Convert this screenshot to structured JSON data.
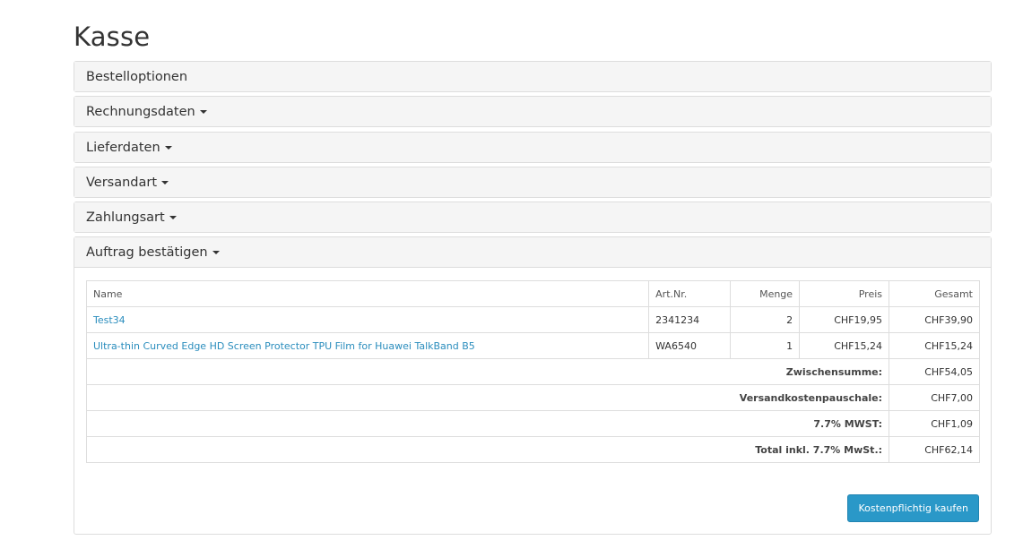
{
  "page": {
    "title": "Kasse"
  },
  "sections": [
    {
      "label": "Bestelloptionen",
      "caret": false
    },
    {
      "label": "Rechnungsdaten",
      "caret": true
    },
    {
      "label": "Lieferdaten",
      "caret": true
    },
    {
      "label": "Versandart",
      "caret": true
    },
    {
      "label": "Zahlungsart",
      "caret": true
    },
    {
      "label": "Auftrag bestätigen",
      "caret": true
    }
  ],
  "table": {
    "headers": {
      "name": "Name",
      "artnr": "Art.Nr.",
      "menge": "Menge",
      "preis": "Preis",
      "gesamt": "Gesamt"
    },
    "rows": [
      {
        "name": "Test34",
        "artnr": "2341234",
        "menge": "2",
        "preis": "CHF19,95",
        "gesamt": "CHF39,90"
      },
      {
        "name": "Ultra-thin Curved Edge HD Screen Protector TPU Film for Huawei TalkBand B5",
        "artnr": "WA6540",
        "menge": "1",
        "preis": "CHF15,24",
        "gesamt": "CHF15,24"
      }
    ],
    "summary": [
      {
        "label": "Zwischensumme:",
        "value": "CHF54,05"
      },
      {
        "label": "Versandkostenpauschale:",
        "value": "CHF7,00"
      },
      {
        "label": "7.7% MWST:",
        "value": "CHF1,09"
      },
      {
        "label": "Total inkl. 7.7% MwSt.:",
        "value": "CHF62,14"
      }
    ]
  },
  "actions": {
    "buy_label": "Kostenpflichtig kaufen"
  },
  "colors": {
    "link": "#2a8dbd",
    "button": "#2a98c8",
    "panel_heading": "#f5f5f5",
    "border": "#dddddd"
  }
}
